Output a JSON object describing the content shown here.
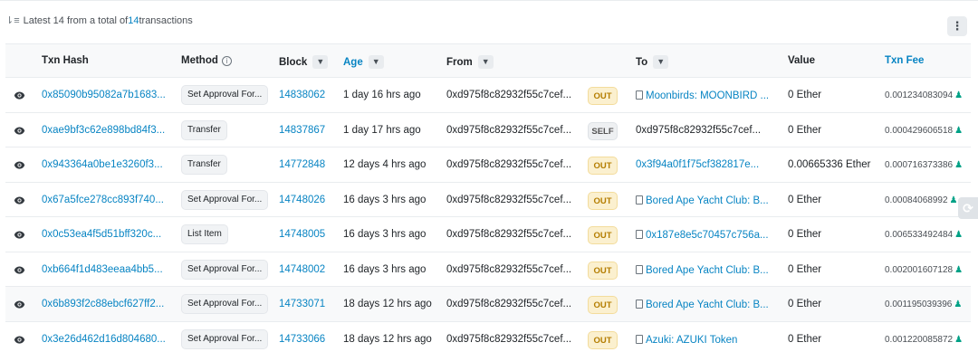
{
  "summary": {
    "prefix": "Latest 14 from a total of ",
    "count": "14",
    "suffix": " transactions"
  },
  "columns": {
    "hash": "Txn Hash",
    "method": "Method",
    "block": "Block",
    "age": "Age",
    "from": "From",
    "to": "To",
    "value": "Value",
    "fee": "Txn Fee"
  },
  "rows": [
    {
      "hash": "0x85090b95082a7b1683...",
      "method": "Set Approval For...",
      "block": "14838062",
      "age": "1 day 16 hrs ago",
      "from": "0xd975f8c82932f55c7cef...",
      "dir": "OUT",
      "to": "Moonbirds: MOONBIRD ...",
      "to_contract": true,
      "to_link": true,
      "value": "0 Ether",
      "fee": "0.001234083094"
    },
    {
      "hash": "0xae9bf3c62e898bd84f3...",
      "method": "Transfer",
      "block": "14837867",
      "age": "1 day 17 hrs ago",
      "from": "0xd975f8c82932f55c7cef...",
      "dir": "SELF",
      "to": "0xd975f8c82932f55c7cef...",
      "to_contract": false,
      "to_link": false,
      "value": "0 Ether",
      "fee": "0.000429606518"
    },
    {
      "hash": "0x943364a0be1e3260f3...",
      "method": "Transfer",
      "block": "14772848",
      "age": "12 days 4 hrs ago",
      "from": "0xd975f8c82932f55c7cef...",
      "dir": "OUT",
      "to": "0x3f94a0f1f75cf382817e...",
      "to_contract": false,
      "to_link": true,
      "value": "0.00665336 Ether",
      "fee": "0.000716373386"
    },
    {
      "hash": "0x67a5fce278cc893f740...",
      "method": "Set Approval For...",
      "block": "14748026",
      "age": "16 days 3 hrs ago",
      "from": "0xd975f8c82932f55c7cef...",
      "dir": "OUT",
      "to": "Bored Ape Yacht Club: B...",
      "to_contract": true,
      "to_link": true,
      "value": "0 Ether",
      "fee": "0.00084068992"
    },
    {
      "hash": "0x0c53ea4f5d51bff320c...",
      "method": "List Item",
      "block": "14748005",
      "age": "16 days 3 hrs ago",
      "from": "0xd975f8c82932f55c7cef...",
      "dir": "OUT",
      "to": "0x187e8e5c70457c756a...",
      "to_contract": true,
      "to_link": true,
      "value": "0 Ether",
      "fee": "0.006533492484"
    },
    {
      "hash": "0xb664f1d483eeaa4bb5...",
      "method": "Set Approval For...",
      "block": "14748002",
      "age": "16 days 3 hrs ago",
      "from": "0xd975f8c82932f55c7cef...",
      "dir": "OUT",
      "to": "Bored Ape Yacht Club: B...",
      "to_contract": true,
      "to_link": true,
      "value": "0 Ether",
      "fee": "0.002001607128"
    },
    {
      "hash": "0x6b893f2c88ebcf627ff2...",
      "method": "Set Approval For...",
      "block": "14733071",
      "age": "18 days 12 hrs ago",
      "from": "0xd975f8c82932f55c7cef...",
      "dir": "OUT",
      "to": "Bored Ape Yacht Club: B...",
      "to_contract": true,
      "to_link": true,
      "value": "0 Ether",
      "fee": "0.001195039396"
    },
    {
      "hash": "0x3e26d462d16d804680...",
      "method": "Set Approval For...",
      "block": "14733066",
      "age": "18 days 12 hrs ago",
      "from": "0xd975f8c82932f55c7cef...",
      "dir": "OUT",
      "to": "Azuki: AZUKI Token",
      "to_contract": true,
      "to_link": true,
      "value": "0 Ether",
      "fee": "0.001220085872"
    }
  ],
  "colors": {
    "link": "#0784c3",
    "out_badge": "#fbf0cf",
    "gas_icon": "#00a186"
  }
}
